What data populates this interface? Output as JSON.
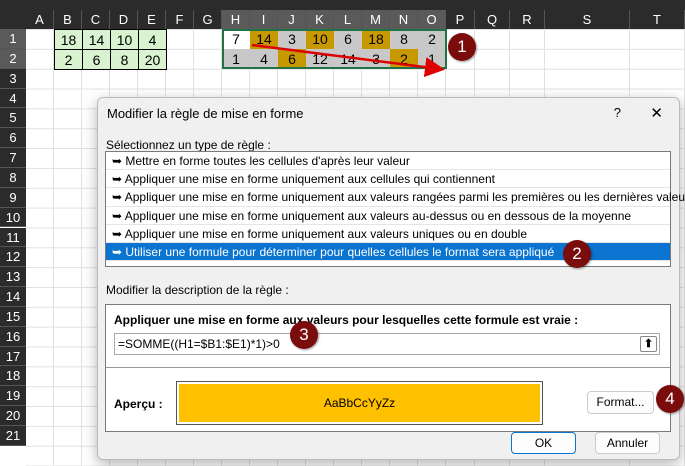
{
  "columns": [
    "A",
    "B",
    "C",
    "D",
    "E",
    "F",
    "G",
    "H",
    "I",
    "J",
    "K",
    "L",
    "M",
    "N",
    "O",
    "P",
    "Q",
    "R",
    "S",
    "T"
  ],
  "rows": [
    "1",
    "2",
    "3",
    "4",
    "5",
    "6",
    "7",
    "8",
    "9",
    "10",
    "11",
    "12",
    "13",
    "14",
    "15",
    "16",
    "17",
    "18",
    "19",
    "20",
    "21"
  ],
  "lookup_values": [
    [
      "18",
      "14",
      "10",
      "4"
    ],
    [
      "2",
      "6",
      "8",
      "20"
    ]
  ],
  "target_values": [
    [
      "7",
      "14",
      "3",
      "10",
      "6",
      "18",
      "8",
      "2"
    ],
    [
      "1",
      "4",
      "6",
      "12",
      "14",
      "3",
      "2",
      "1"
    ]
  ],
  "target_fill": [
    [
      "white",
      "gold",
      "grey",
      "gold",
      "grey",
      "gold",
      "grey",
      "grey"
    ],
    [
      "grey",
      "grey",
      "gold",
      "grey",
      "grey",
      "grey",
      "gold",
      "grey"
    ]
  ],
  "colors": {
    "gold": "#c89800",
    "grey": "#c8c8c8",
    "white": "#ffffff",
    "lookup": "#d9f2d0",
    "preview": "#ffc000",
    "selection": "#0a74d0",
    "badge": "#7b0c0c"
  },
  "badges": [
    "1",
    "2",
    "3",
    "4"
  ],
  "dialog": {
    "title": "Modifier la règle de mise en forme",
    "help": "?",
    "close": "✕",
    "rule_type_label": "Sélectionnez un type de règle :",
    "rule_types": [
      "Mettre en forme toutes les cellules d'après leur valeur",
      "Appliquer une mise en forme uniquement aux cellules qui contiennent",
      "Appliquer une mise en forme uniquement aux valeurs rangées parmi les premières ou les dernières valeurs",
      "Appliquer une mise en forme uniquement aux valeurs au-dessus ou en dessous de la moyenne",
      "Appliquer une mise en forme uniquement aux valeurs uniques ou en double",
      "Utiliser une formule pour déterminer pour quelles cellules le format sera appliqué"
    ],
    "selected_rule": 5,
    "desc_label": "Modifier la description de la règle :",
    "formula_label": "Appliquer une mise en forme aux valeurs pour lesquelles cette formule est vraie :",
    "formula": "=SOMME((H1=$B1:$E1)*1)>0",
    "preview_label": "Aperçu :",
    "preview_text": "AaBbCcYyZz",
    "format_button": "Format...",
    "ok_button": "OK",
    "cancel_button": "Annuler"
  }
}
